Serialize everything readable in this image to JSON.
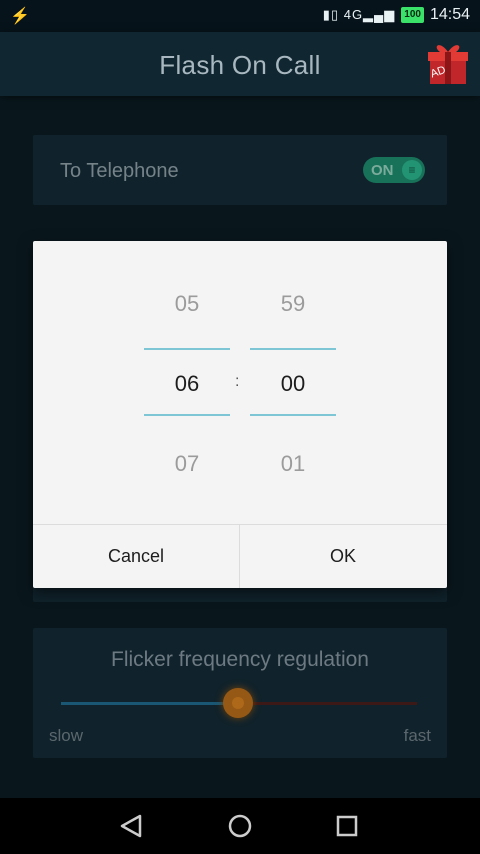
{
  "status_bar": {
    "usb_icon": "usb-icon",
    "network": "4G",
    "battery": "100",
    "time": "14:54"
  },
  "app_bar": {
    "title": "Flash On Call",
    "ad_label": "AD"
  },
  "telephone_card": {
    "label": "To Telephone",
    "toggle_label": "ON",
    "toggle_state": "on"
  },
  "time_picker": {
    "hour_prev": "05",
    "hour_selected": "06",
    "hour_next": "07",
    "separator": ":",
    "minute_prev": "59",
    "minute_selected": "00",
    "minute_next": "01",
    "cancel_label": "Cancel",
    "ok_label": "OK"
  },
  "flicker_card": {
    "title": "Flicker frequency regulation",
    "slider_value_fraction": 0.44,
    "min_label": "slow",
    "max_label": "fast"
  },
  "colors": {
    "toggle_on": "#1e8a6d",
    "slider_accent": "#b86d1a",
    "picker_line": "#7ec6d6"
  }
}
